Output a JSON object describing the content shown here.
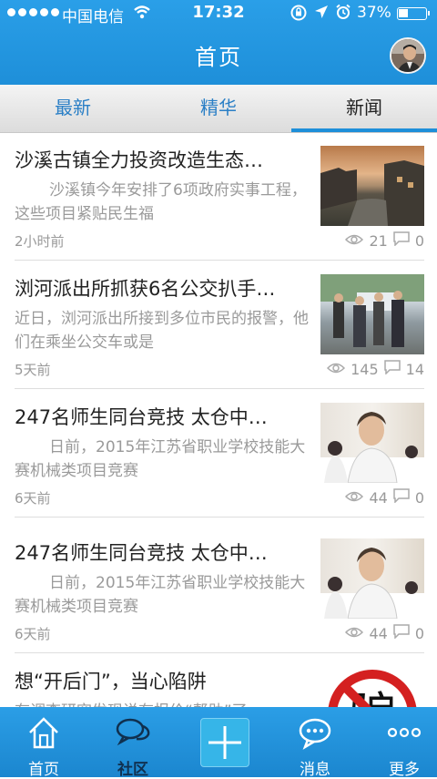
{
  "status": {
    "carrier": "中国电信",
    "time": "17:32",
    "battery_pct": "37%",
    "battery_level": 0.37
  },
  "header": {
    "title": "首页"
  },
  "tabs": [
    {
      "label": "最新"
    },
    {
      "label": "精华"
    },
    {
      "label": "新闻"
    }
  ],
  "news": [
    {
      "title": "沙溪古镇全力投资改造生态…",
      "desc": "沙溪镇今年安排了6项政府实事工程，这些项目紧贴民生福",
      "time": "2小时前",
      "views": "21",
      "comments": "0"
    },
    {
      "title": "浏河派出所抓获6名公交扒手…",
      "desc": "近日，浏河派出所接到多位市民的报警，他们在乘坐公交车或是",
      "time": "5天前",
      "views": "145",
      "comments": "14"
    },
    {
      "title": "247名师生同台竞技 太仓中…",
      "desc": "日前，2015年江苏省职业学校技能大赛机械类项目竞赛",
      "time": "6天前",
      "views": "44",
      "comments": "0"
    },
    {
      "title": "247名师生同台竞技 太仓中…",
      "desc": "日前，2015年江苏省职业学校技能大赛机械类项目竞赛",
      "time": "6天前",
      "views": "44",
      "comments": "0"
    },
    {
      "title": "想“开后门”，当心陷阱",
      "desc": "有调查研究发现说有报价“帮助”了…",
      "time": "",
      "views": "",
      "comments": ""
    }
  ],
  "bottom_nav": [
    {
      "label": "首页",
      "icon": "home-icon"
    },
    {
      "label": "社区",
      "icon": "chat-bubbles-icon"
    },
    {
      "label": "",
      "icon": "plus-icon"
    },
    {
      "label": "消息",
      "icon": "message-icon"
    },
    {
      "label": "更多",
      "icon": "more-icon"
    }
  ]
}
